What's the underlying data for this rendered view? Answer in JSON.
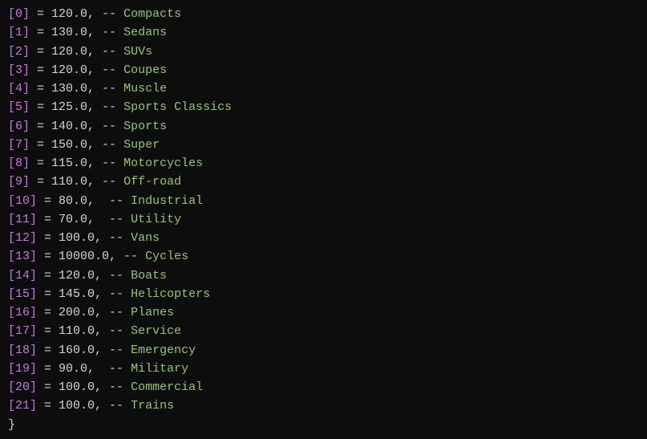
{
  "entries": [
    {
      "index": "[0]",
      "value": "120.0,",
      "separator": " -- ",
      "label": "Compacts"
    },
    {
      "index": "[1]",
      "value": "130.0,",
      "separator": " -- ",
      "label": "Sedans"
    },
    {
      "index": "[2]",
      "value": "120.0,",
      "separator": " -- ",
      "label": "SUVs"
    },
    {
      "index": "[3]",
      "value": "120.0,",
      "separator": " -- ",
      "label": "Coupes"
    },
    {
      "index": "[4]",
      "value": "130.0,",
      "separator": " -- ",
      "label": "Muscle"
    },
    {
      "index": "[5]",
      "value": "125.0,",
      "separator": " -- ",
      "label": "Sports Classics"
    },
    {
      "index": "[6]",
      "value": "140.0,",
      "separator": " -- ",
      "label": "Sports"
    },
    {
      "index": "[7]",
      "value": "150.0,",
      "separator": " -- ",
      "label": "Super"
    },
    {
      "index": "[8]",
      "value": "115.0,",
      "separator": " -- ",
      "label": "Motorcycles"
    },
    {
      "index": "[9]",
      "value": "110.0,",
      "separator": " -- ",
      "label": "Off-road"
    },
    {
      "index": "[10]",
      "value": "80.0,",
      "separator": "  -- ",
      "label": "Industrial"
    },
    {
      "index": "[11]",
      "value": "70.0,",
      "separator": "  -- ",
      "label": "Utility"
    },
    {
      "index": "[12]",
      "value": "100.0,",
      "separator": " -- ",
      "label": "Vans"
    },
    {
      "index": "[13]",
      "value": "10000.0,",
      "separator": " -- ",
      "label": "Cycles"
    },
    {
      "index": "[14]",
      "value": "120.0,",
      "separator": " -- ",
      "label": "Boats"
    },
    {
      "index": "[15]",
      "value": "145.0,",
      "separator": " -- ",
      "label": "Helicopters"
    },
    {
      "index": "[16]",
      "value": "200.0,",
      "separator": " -- ",
      "label": "Planes"
    },
    {
      "index": "[17]",
      "value": "110.0,",
      "separator": " -- ",
      "label": "Service"
    },
    {
      "index": "[18]",
      "value": "160.0,",
      "separator": " -- ",
      "label": "Emergency"
    },
    {
      "index": "[19]",
      "value": "90.0,",
      "separator": "  -- ",
      "label": "Military"
    },
    {
      "index": "[20]",
      "value": "100.0,",
      "separator": " -- ",
      "label": "Commercial"
    },
    {
      "index": "[21]",
      "value": "100.0,",
      "separator": " -- ",
      "label": "Trains"
    }
  ],
  "closing": "}"
}
